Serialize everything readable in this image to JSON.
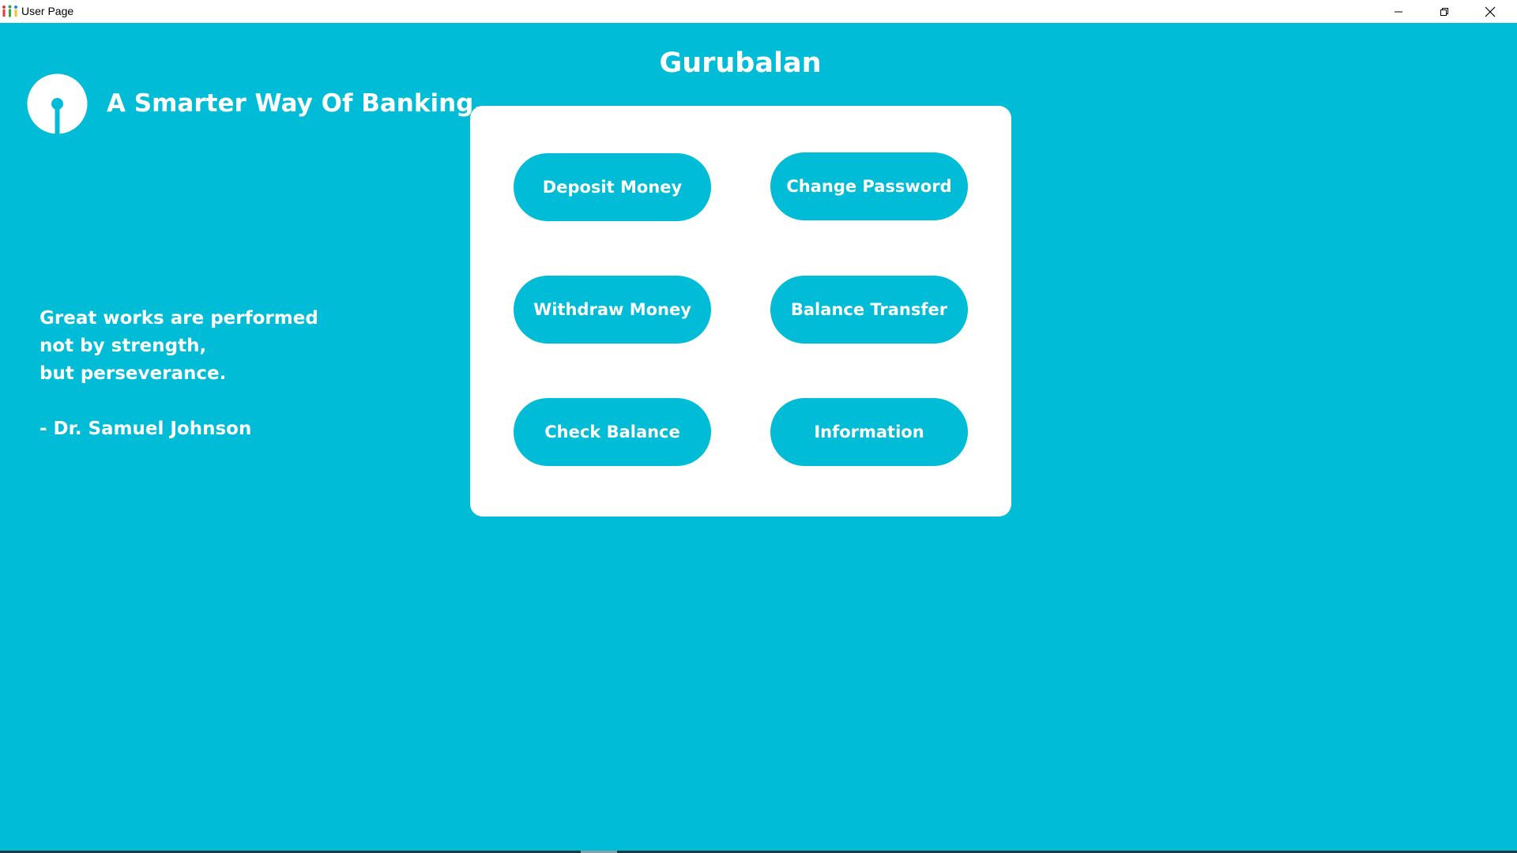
{
  "window": {
    "title": "User Page",
    "app_icon": "people-chart-icon",
    "controls": [
      "minimize-icon",
      "restore-icon",
      "close-icon"
    ]
  },
  "brand": {
    "logo": "sbi-bank-logo",
    "tagline": "A Smarter Way Of Banking."
  },
  "user": {
    "name": "Gurubalan"
  },
  "quote": {
    "line1": "Great works are performed",
    "line2": "not by strength,",
    "line3": "but perseverance.",
    "author": "- Dr. Samuel Johnson"
  },
  "actions": {
    "deposit": "Deposit Money",
    "change_password": "Change Password",
    "withdraw": "Withdraw Money",
    "balance_transfer": "Balance Transfer",
    "check_balance": "Check Balance",
    "information": "Information"
  },
  "colors": {
    "background": "#00bcd6",
    "card": "#ffffff",
    "button": "#00bcd6",
    "text": "#ffffff"
  }
}
